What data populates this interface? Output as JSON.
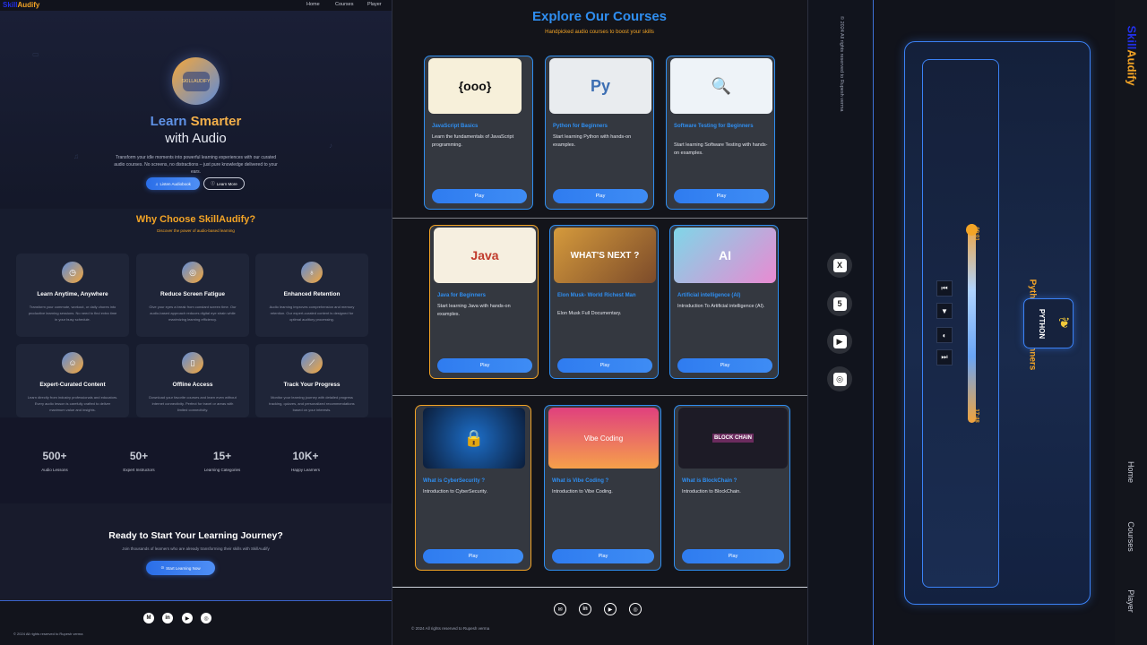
{
  "home": {
    "brand": {
      "prefix": "Skill",
      "suffix": "Audify"
    },
    "nav": [
      "Home",
      "Courses",
      "Player"
    ],
    "hero": {
      "logo_text": "SKILLAUDIFY",
      "title_learn": "Learn",
      "title_smarter": "Smarter",
      "title_line2": "with Audio",
      "description": "Transform your idle moments into powerful learning experiences with our curated audio courses. No screens, no distractions – just pure knowledge delivered to your ears.",
      "primary_button": "Listen Audiobook",
      "secondary_button": "Learn More"
    },
    "why": {
      "title": "Why Choose SkillAudify?",
      "subtitle": "Discover the power of audio-based learning",
      "features": [
        {
          "icon": "clock-icon",
          "title": "Learn Anytime, Anywhere",
          "desc": "Transform your commute, workout, or daily chores into productive learning sessions. No need to find extra time in your busy schedule."
        },
        {
          "icon": "eye-slash-icon",
          "title": "Reduce Screen Fatigue",
          "desc": "Give your eyes a break from constant screen time. Our audio-based approach reduces digital eye strain while maximizing learning efficiency."
        },
        {
          "icon": "lightbulb-icon",
          "title": "Enhanced Retention",
          "desc": "Audio learning improves comprehension and memory retention. Our expert-curated content is designed for optimal auditory processing."
        },
        {
          "icon": "users-icon",
          "title": "Expert-Curated Content",
          "desc": "Learn directly from industry professionals and educators. Every audio lesson is carefully crafted to deliver maximum value and insights."
        },
        {
          "icon": "mobile-icon",
          "title": "Offline Access",
          "desc": "Download your favorite courses and learn even without internet connectivity. Perfect for travel or areas with limited connectivity."
        },
        {
          "icon": "chart-icon",
          "title": "Track Your Progress",
          "desc": "Monitor your learning journey with detailed progress tracking, quizzes, and personalized recommendations based on your interests."
        }
      ]
    },
    "stats": [
      {
        "num": "500+",
        "label": "Audio Lessons"
      },
      {
        "num": "50+",
        "label": "Expert Instructors"
      },
      {
        "num": "15+",
        "label": "Learning Categories"
      },
      {
        "num": "10K+",
        "label": "Happy Learners"
      }
    ],
    "cta": {
      "title": "Ready to Start Your Learning Journey?",
      "text": "Join thousands of learners who are already transforming their skills with SkillAudify",
      "button": "Start Learning Now"
    },
    "footer": {
      "copyright": "© 2024 All rights reserved to Rupesh verma",
      "icons": [
        "M",
        "in",
        "▶",
        "◎"
      ]
    }
  },
  "courses": {
    "title": "Explore Our Courses",
    "subtitle": "Handpicked audio courses to boost your skills",
    "play_label": "Play",
    "items": [
      {
        "title": "JavaScript Basics",
        "desc": "Learn the fundamentals of JavaScript programming.",
        "thumb": "{ooo}"
      },
      {
        "title": "Python for Beginners",
        "desc": "Start learning Python with hands-on examples.",
        "thumb": "Py"
      },
      {
        "title": "Software Testing for Beginners",
        "desc": "Start learning Software Testing with hands-on examples.",
        "thumb": "🔍"
      },
      {
        "title": "Java for Beginners",
        "desc": "Start learning Java with hands-on examples.",
        "thumb": "Java"
      },
      {
        "title": "Elon Musk- World Richest Man",
        "desc": "Elon Musk Full Documentary.",
        "thumb": "WHAT'S NEXT ?"
      },
      {
        "title": "Artificial intelligence (AI)",
        "desc": "Introduction To Artificial intelligence (AI).",
        "thumb": "AI"
      },
      {
        "title": "What is CyberSecurity ?",
        "desc": "Introduction to CyberSecurity.",
        "thumb": "🔒"
      },
      {
        "title": "What is Vibe Coding ?",
        "desc": "Introduction to Vibe Coding.",
        "thumb": "Vibe Coding"
      },
      {
        "title": "What is BlockChain ?",
        "desc": "Introduction to BlockChain.",
        "thumb": "BLOCK CHAIN"
      }
    ],
    "footer": {
      "copyright": "© 2024 All rights reserved to Rupesh verma",
      "icons": [
        "✉",
        "in",
        "▶",
        "◎"
      ]
    }
  },
  "social": {
    "copyright": "© 2024 All rights reserved to Rupesh verma",
    "icons": [
      "X",
      "5",
      "▶",
      "◎"
    ]
  },
  "player": {
    "course_title": "Python for Beginners",
    "logo_text": "PYTHON",
    "time_current": "00:01",
    "time_total": "17:48",
    "progress": 0.0,
    "controls": [
      "⏮",
      "▼",
      "◐",
      "⏭"
    ]
  },
  "vnav": {
    "brand_prefix": "Skill",
    "brand_suffix": "Audify",
    "links": [
      "Home",
      "Courses",
      "Player"
    ]
  },
  "colors": {
    "accent_blue": "#2f8ef0",
    "accent_orange": "#f3a426",
    "brand_blue": "#2230e6"
  }
}
